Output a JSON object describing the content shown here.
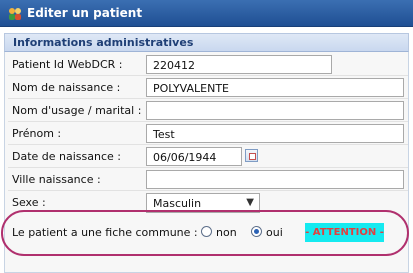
{
  "window": {
    "title": "Editer un patient",
    "icon": "users-icon"
  },
  "section": {
    "title": "Informations administratives"
  },
  "fields": {
    "patient_id": {
      "label": "Patient Id WebDCR :",
      "value": "220412"
    },
    "birth_name": {
      "label": "Nom de naissance :",
      "value": "POLYVALENTE"
    },
    "usage_name": {
      "label": "Nom d'usage / marital :",
      "value": ""
    },
    "first_name": {
      "label": "Prénom :",
      "value": "Test"
    },
    "birth_date": {
      "label": "Date de naissance :",
      "value": "06/06/1944"
    },
    "birth_city": {
      "label": "Ville naissance :",
      "value": ""
    },
    "sex": {
      "label": "Sexe :",
      "value": "Masculin"
    }
  },
  "common_record": {
    "label": "Le patient a une fiche commune :",
    "options": [
      {
        "label": "non",
        "checked": false
      },
      {
        "label": "oui",
        "checked": true
      }
    ],
    "attention": "- ATTENTION -"
  },
  "colors": {
    "titlebar": "#2b5ea3",
    "highlight_oval": "#b0306e",
    "attention_bg": "#15eaf0",
    "attention_text": "#e23f3f"
  }
}
